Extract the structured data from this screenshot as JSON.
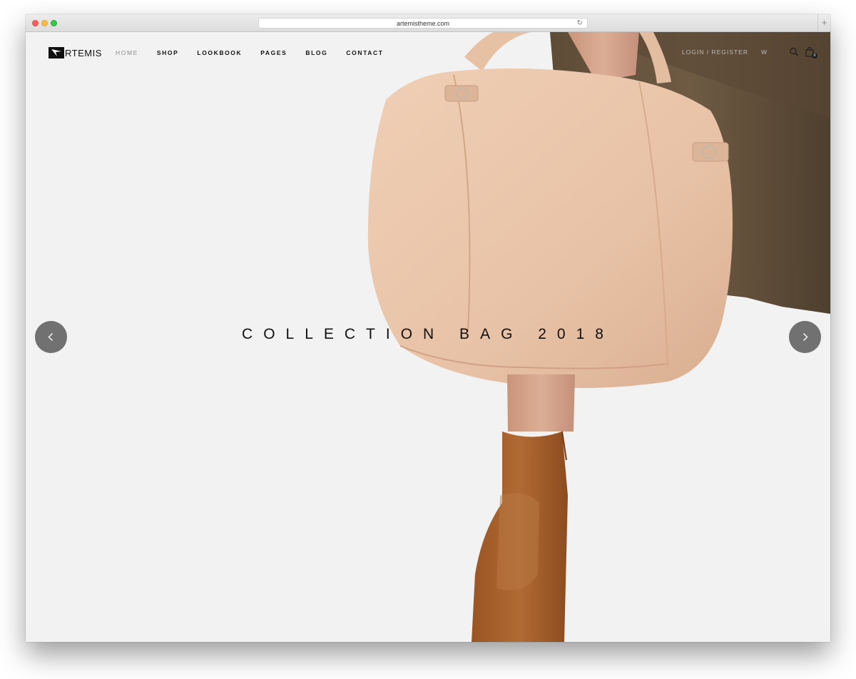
{
  "browser": {
    "url": "artemistheme.com"
  },
  "header": {
    "logo_text": "RTEMIS",
    "nav": [
      {
        "label": "HOME",
        "active": true
      },
      {
        "label": "SHOP"
      },
      {
        "label": "LOOKBOOK"
      },
      {
        "label": "PAGES"
      },
      {
        "label": "BLOG"
      },
      {
        "label": "CONTACT"
      }
    ],
    "login_label": "LOGIN / REGISTER",
    "language_label": "W",
    "cart_count": "0"
  },
  "slider": {
    "title": "COLLECTION BAG 2018",
    "prev_icon": "chevron-left-icon",
    "next_icon": "chevron-right-icon"
  },
  "colors": {
    "background": "#f2f2f2",
    "bag": "#e9c6aa",
    "coat": "#6b5842",
    "boot": "#a8612c",
    "arrow_bg": "#5a5a5a"
  }
}
